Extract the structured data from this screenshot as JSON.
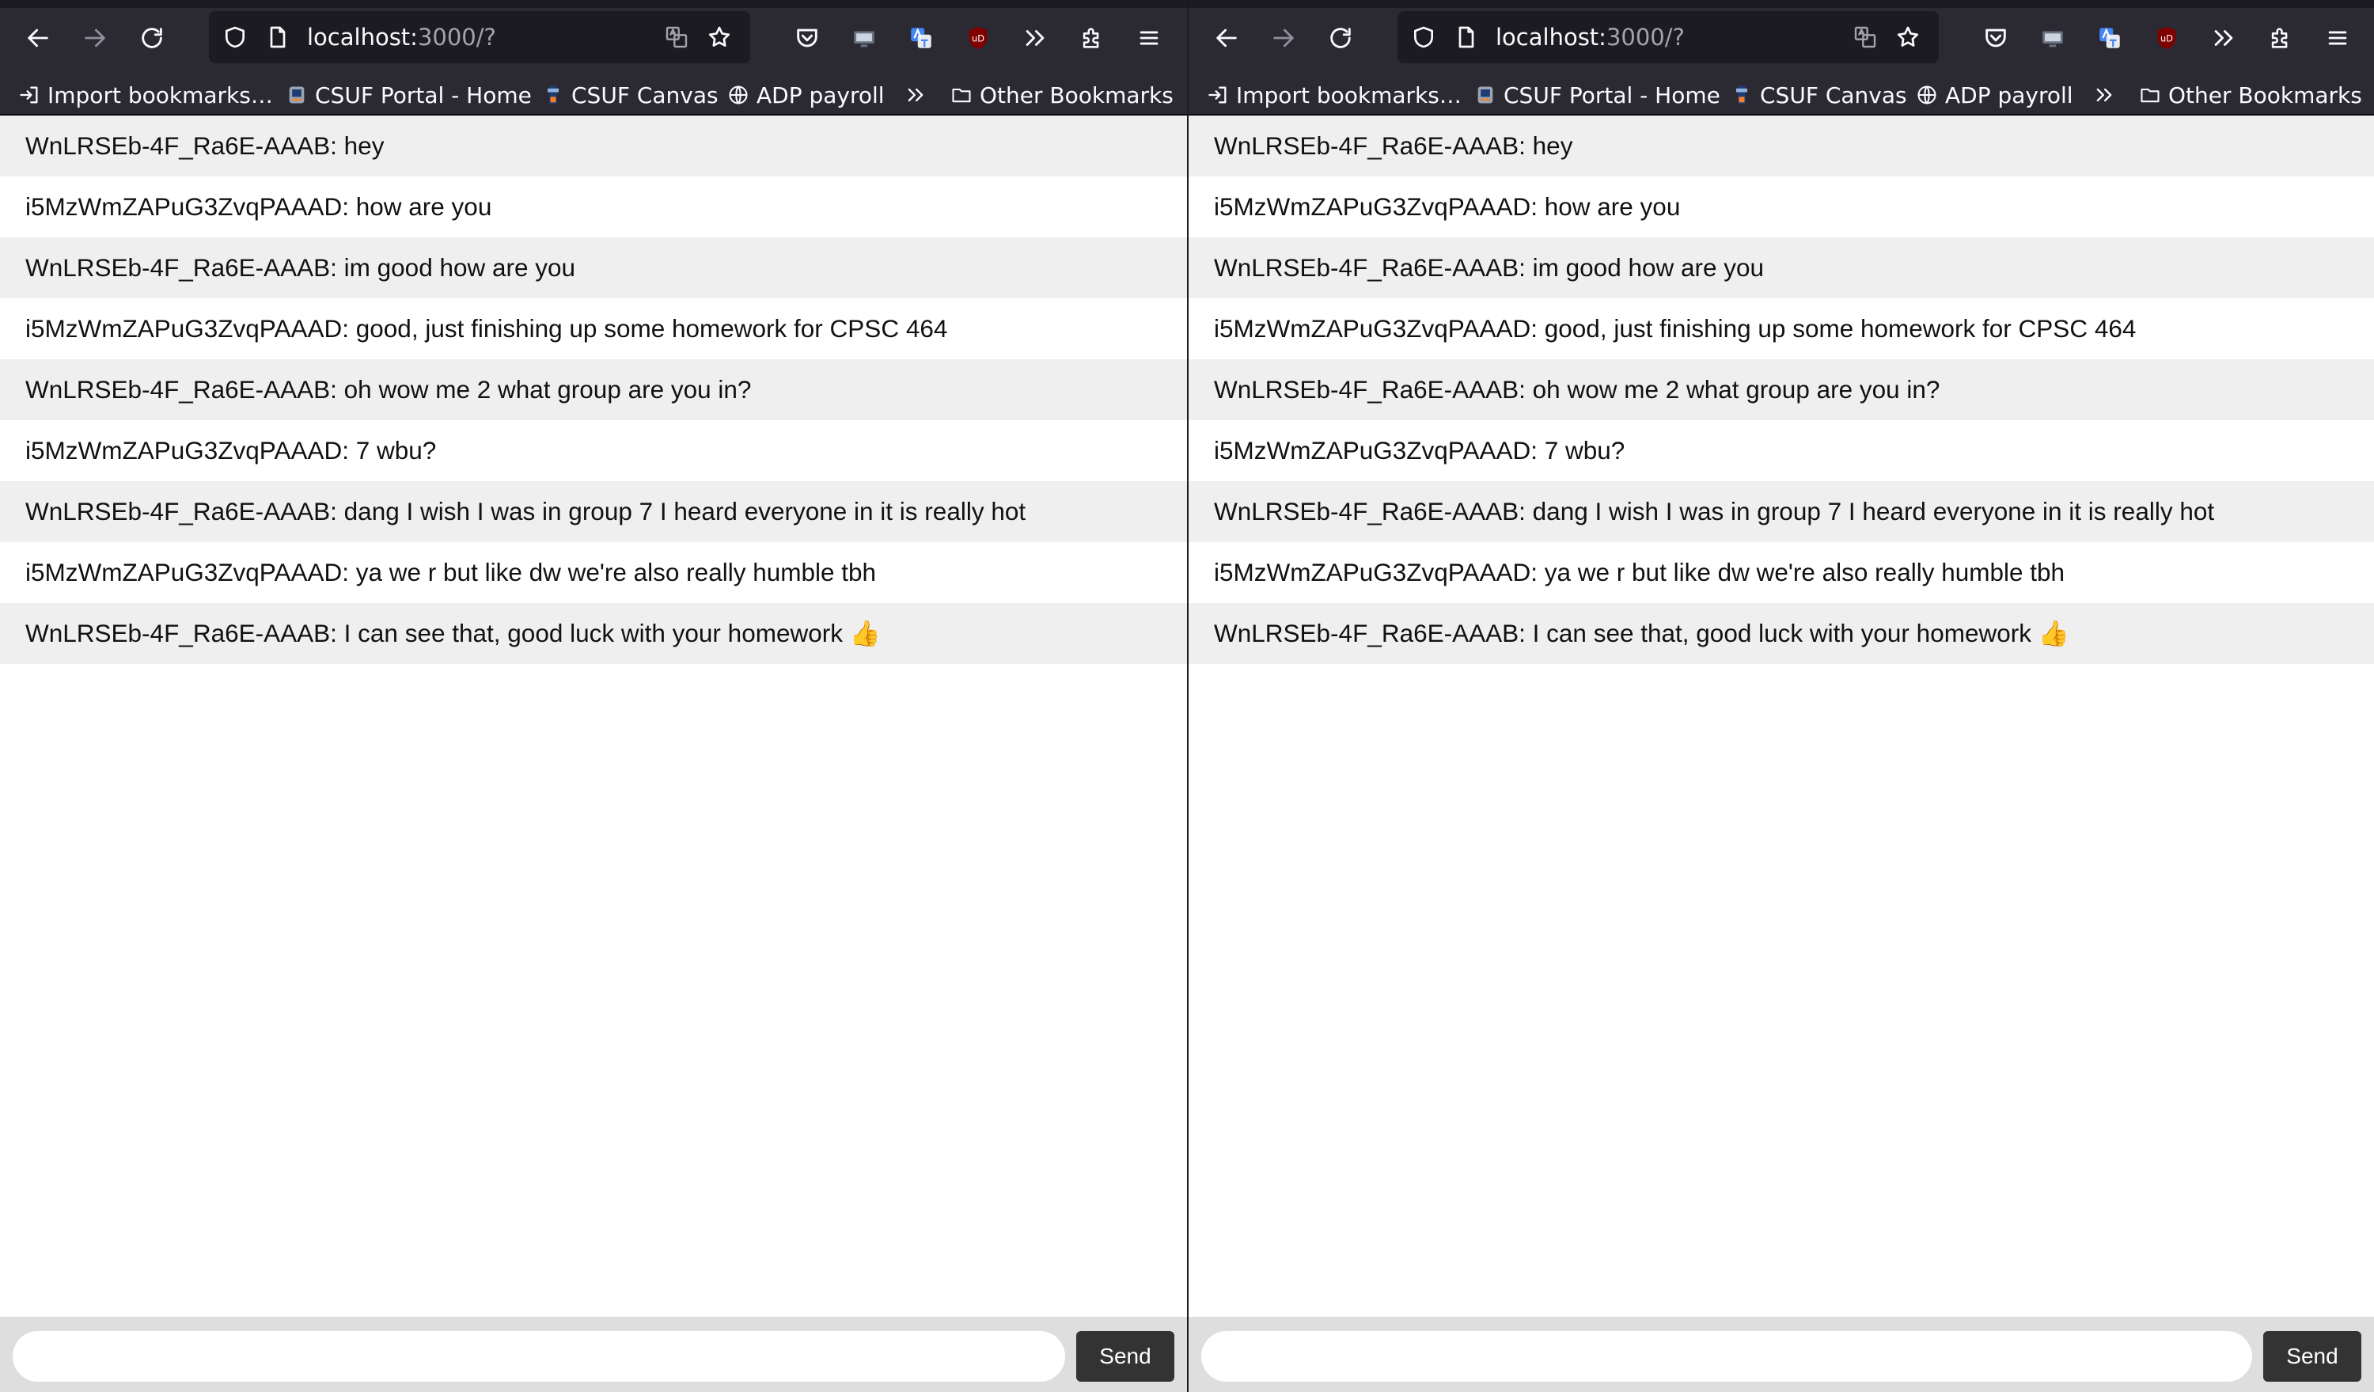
{
  "browser": {
    "url_host": "localhost:",
    "url_path": "3000/?",
    "bookmarks": [
      {
        "label": "Import bookmarks…",
        "icon": "import-icon"
      },
      {
        "label": "CSUF Portal - Home",
        "icon": "csuf-portal-favicon"
      },
      {
        "label": "CSUF Canvas",
        "icon": "csuf-canvas-favicon"
      },
      {
        "label": "ADP payroll",
        "icon": "globe-icon"
      },
      {
        "label": "Other Bookmarks",
        "icon": "folder-icon"
      }
    ]
  },
  "chat": {
    "messages": [
      "WnLRSEb-4F_Ra6E-AAAB: hey",
      "i5MzWmZAPuG3ZvqPAAAD: how are you",
      "WnLRSEb-4F_Ra6E-AAAB: im good how are you",
      "i5MzWmZAPuG3ZvqPAAAD: good, just finishing up some homework for CPSC 464",
      "WnLRSEb-4F_Ra6E-AAAB: oh wow me 2 what group are you in?",
      "i5MzWmZAPuG3ZvqPAAAD: 7 wbu?",
      "WnLRSEb-4F_Ra6E-AAAB: dang I wish I was in group 7 I heard everyone in it is really hot",
      "i5MzWmZAPuG3ZvqPAAAD: ya we r but like dw we're also really humble tbh",
      "WnLRSEb-4F_Ra6E-AAAB: I can see that, good luck with your homework 👍"
    ],
    "input_value": "",
    "send_label": "Send"
  },
  "colors": {
    "toolbar_bg": "#2b2a33",
    "urlbar_bg": "#1c1b22",
    "row_alt": "#efefef",
    "send_button": "#333333"
  }
}
